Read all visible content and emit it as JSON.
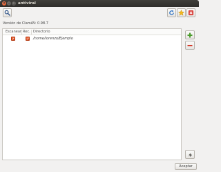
{
  "window": {
    "title": "antiviral",
    "close_glyph": "×",
    "min_glyph": "–",
    "max_glyph": "□"
  },
  "toolbar": {
    "search_icon": "search-icon",
    "refresh_icon": "refresh-icon",
    "favorite_icon": "star-icon",
    "close_icon": "close-icon"
  },
  "version_label": "Versión de ClamAV: 0.98.7",
  "table": {
    "columns": [
      "Escanear",
      "Rec.",
      "Directorio"
    ],
    "rows": [
      {
        "scan": true,
        "recursive": true,
        "path": "/home/lorenzo/Ejemplo"
      }
    ]
  },
  "sidebar": {
    "add_icon": "plus-icon",
    "remove_icon": "minus-icon",
    "clear_icon": "eraser-icon"
  },
  "footer": {
    "accept_label": "Aceptar"
  },
  "colors": {
    "accent_orange": "#e4511e",
    "add_green": "#4a9b2a",
    "remove_red": "#d43c2c"
  }
}
